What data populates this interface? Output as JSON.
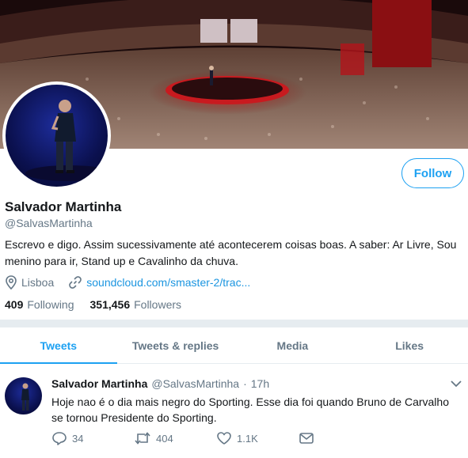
{
  "profile": {
    "name": "Salvador Martinha",
    "handle": "@SalvasMartinha",
    "bio": "Escrevo e digo. Assim sucessivamente até acontecerem coisas boas. A saber: Ar Livre, Sou menino para ir, Stand up e Cavalinho da chuva.",
    "location": "Lisboa",
    "website": "soundcloud.com/smaster-2/trac...",
    "follow_label": "Follow",
    "following_count": "409",
    "following_label": "Following",
    "followers_count": "351,456",
    "followers_label": "Followers"
  },
  "tabs": [
    {
      "label": "Tweets",
      "active": true
    },
    {
      "label": "Tweets & replies",
      "active": false
    },
    {
      "label": "Media",
      "active": false
    },
    {
      "label": "Likes",
      "active": false
    }
  ],
  "tweet": {
    "author_name": "Salvador Martinha",
    "author_handle": "@SalvasMartinha",
    "separator": "·",
    "time": "17h",
    "text": "Hoje nao é o dia mais negro do Sporting. Esse dia foi quando Bruno de Carvalho se tornou Presidente do Sporting.",
    "replies": "34",
    "retweets": "404",
    "likes": "1.1K"
  },
  "colors": {
    "accent": "#1da1f2",
    "link": "#1b95e0",
    "muted": "#657786",
    "text": "#14171a",
    "band": "#e6ecf0"
  },
  "icons": [
    "location-pin-icon",
    "link-icon",
    "reply-icon",
    "retweet-icon",
    "like-icon",
    "message-icon",
    "chevron-down-icon"
  ]
}
